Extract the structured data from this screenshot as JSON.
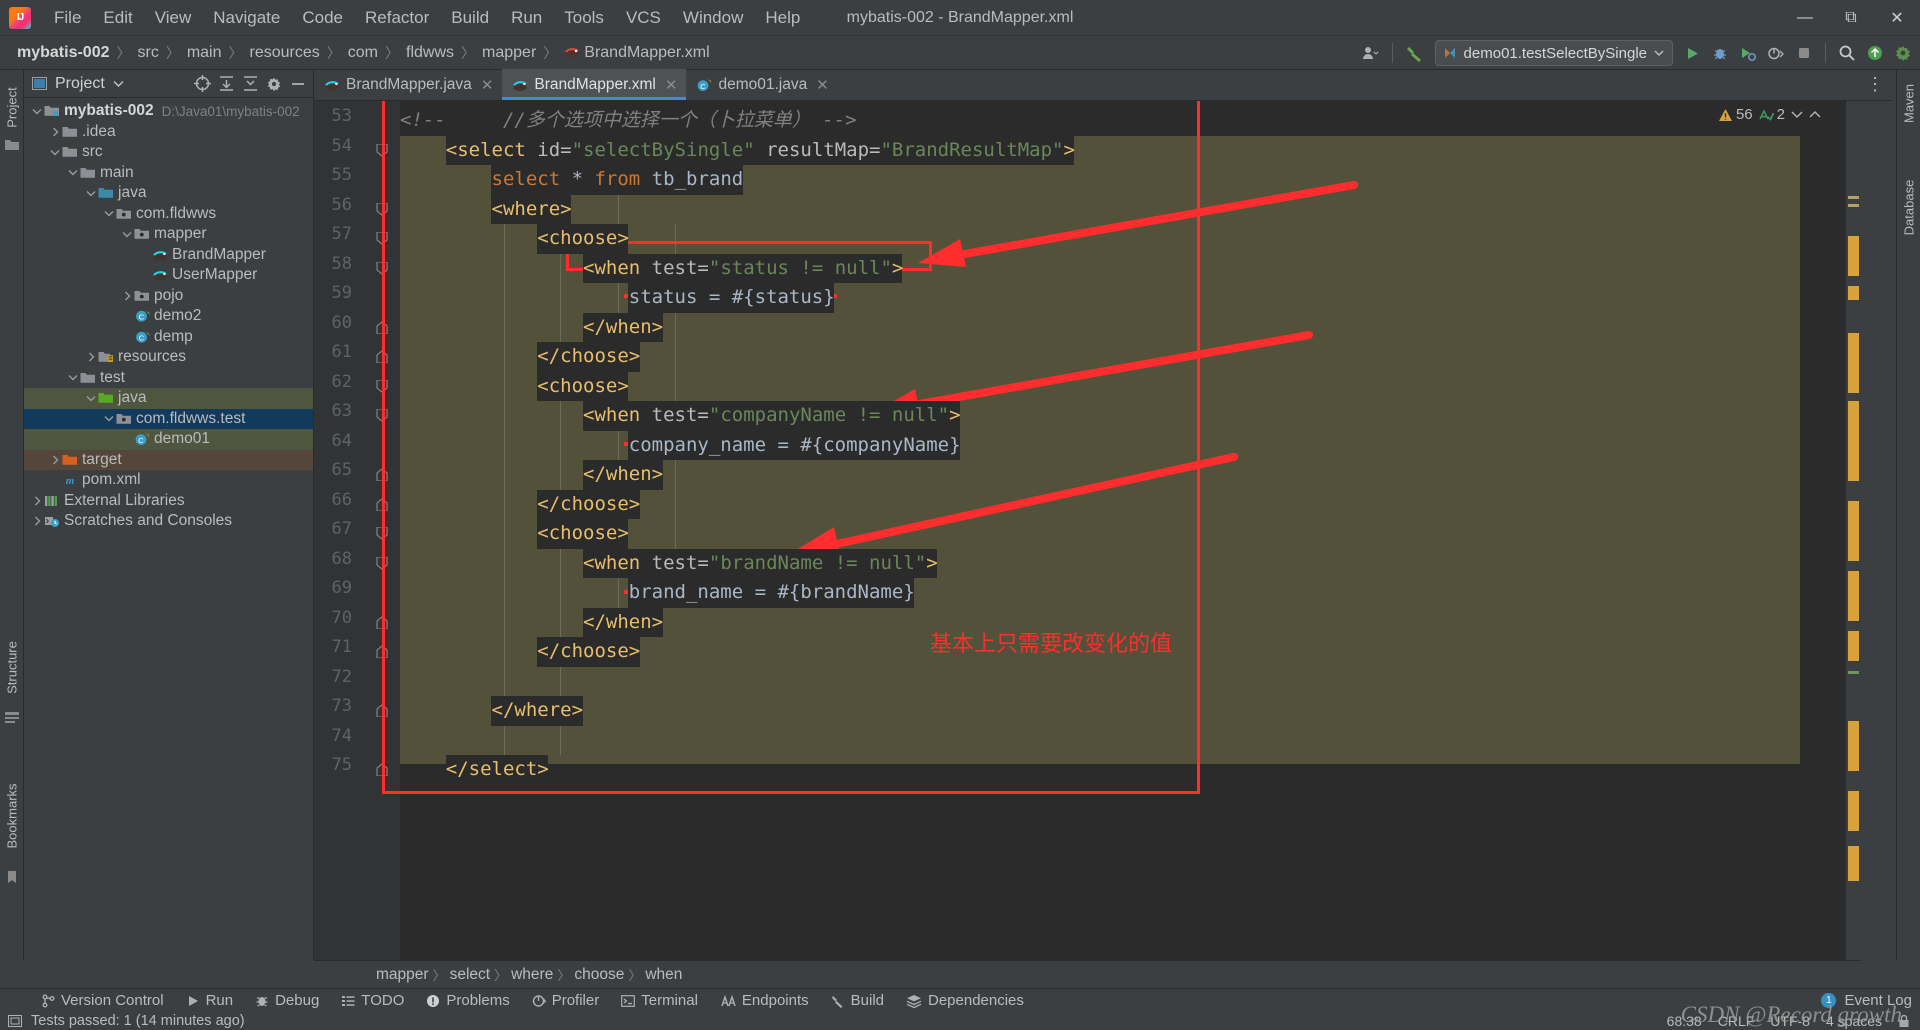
{
  "window": {
    "title": "mybatis-002 - BrandMapper.xml",
    "logo_icon": "intellij-idea-logo",
    "controls": [
      {
        "name": "minimize-button",
        "glyph": "—"
      },
      {
        "name": "maximize-button",
        "glyph": "❐"
      },
      {
        "name": "close-button",
        "glyph": "✕"
      }
    ]
  },
  "menubar": {
    "items": [
      "File",
      "Edit",
      "View",
      "Navigate",
      "Code",
      "Refactor",
      "Build",
      "Run",
      "Tools",
      "VCS",
      "Window",
      "Help"
    ]
  },
  "navbar": {
    "crumbs": [
      {
        "label": "mybatis-002",
        "bold": true,
        "icon": ""
      },
      {
        "label": "src",
        "bold": false,
        "icon": ""
      },
      {
        "label": "main",
        "bold": false,
        "icon": ""
      },
      {
        "label": "resources",
        "bold": false,
        "icon": ""
      },
      {
        "label": "com",
        "bold": false,
        "icon": ""
      },
      {
        "label": "fldwws",
        "bold": false,
        "icon": ""
      },
      {
        "label": "mapper",
        "bold": false,
        "icon": ""
      },
      {
        "label": "BrandMapper.xml",
        "bold": false,
        "icon": "mybatis-file-icon"
      }
    ],
    "separator": "〉",
    "right": {
      "account_icon": "user-account-icon",
      "account_dropdown_icon": "chevron-down-icon",
      "build_icon": "hammer-build-icon",
      "run_config": {
        "icon": "run-config-icon",
        "label": "demo01.testSelectBySingle",
        "dropdown_icon": "chevron-down-icon"
      },
      "run_button": "run-icon",
      "debug_button": "debug-icon",
      "run_coverage_button": "run-with-coverage-icon",
      "profiler_button": "profiler-icon",
      "stop_button": "stop-icon",
      "search_button": "search-icon",
      "updates_button": "updates-icon",
      "settings_button": "settings-icon"
    }
  },
  "left_strip": {
    "project_label": "Project",
    "structure_label": "Structure",
    "bookmarks_label": "Bookmarks",
    "commit_icon": "commit-icon"
  },
  "right_strip": {
    "maven_label": "Maven",
    "database_label": "Database"
  },
  "project_panel": {
    "title": "Project",
    "title_dropdown_icon": "chevron-down-icon",
    "actions": [
      {
        "name": "select-opened-file-button",
        "icon": "crosshair-icon"
      },
      {
        "name": "expand-all-button",
        "icon": "expand-all-icon"
      },
      {
        "name": "collapse-all-button",
        "icon": "collapse-all-icon"
      },
      {
        "name": "settings-button",
        "icon": "gear-icon"
      },
      {
        "name": "hide-button",
        "icon": "minus-icon"
      }
    ],
    "tree": [
      {
        "label": "mybatis-002",
        "sub": "D:\\Java01\\mybatis-002",
        "depth": 0,
        "chev": "down",
        "icon": "module-folder-icon",
        "bold": true,
        "state": ""
      },
      {
        "label": ".idea",
        "sub": "",
        "depth": 1,
        "chev": "right",
        "icon": "folder-icon",
        "bold": false,
        "state": ""
      },
      {
        "label": "src",
        "sub": "",
        "depth": 1,
        "chev": "down",
        "icon": "folder-icon",
        "bold": false,
        "state": ""
      },
      {
        "label": "main",
        "sub": "",
        "depth": 2,
        "chev": "down",
        "icon": "folder-icon",
        "bold": false,
        "state": ""
      },
      {
        "label": "java",
        "sub": "",
        "depth": 3,
        "chev": "down",
        "icon": "source-folder-icon",
        "bold": false,
        "state": ""
      },
      {
        "label": "com.fldwws",
        "sub": "",
        "depth": 4,
        "chev": "down",
        "icon": "package-icon",
        "bold": false,
        "state": ""
      },
      {
        "label": "mapper",
        "sub": "",
        "depth": 5,
        "chev": "down",
        "icon": "package-icon",
        "bold": false,
        "state": ""
      },
      {
        "label": "BrandMapper",
        "sub": "",
        "depth": 6,
        "chev": "none",
        "icon": "mybatis-file-icon",
        "bold": false,
        "state": ""
      },
      {
        "label": "UserMapper",
        "sub": "",
        "depth": 6,
        "chev": "none",
        "icon": "mybatis-file-icon",
        "bold": false,
        "state": ""
      },
      {
        "label": "pojo",
        "sub": "",
        "depth": 5,
        "chev": "right",
        "icon": "package-icon",
        "bold": false,
        "state": ""
      },
      {
        "label": "demo2",
        "sub": "",
        "depth": 5,
        "chev": "none",
        "icon": "java-class-icon",
        "bold": false,
        "state": ""
      },
      {
        "label": "demp",
        "sub": "",
        "depth": 5,
        "chev": "none",
        "icon": "java-class-icon",
        "bold": false,
        "state": ""
      },
      {
        "label": "resources",
        "sub": "",
        "depth": 3,
        "chev": "right",
        "icon": "resource-folder-icon",
        "bold": false,
        "state": ""
      },
      {
        "label": "test",
        "sub": "",
        "depth": 2,
        "chev": "down",
        "icon": "folder-icon",
        "bold": false,
        "state": ""
      },
      {
        "label": "java",
        "sub": "",
        "depth": 3,
        "chev": "down",
        "icon": "test-source-folder-icon",
        "bold": false,
        "state": "sel-green"
      },
      {
        "label": "com.fldwws.test",
        "sub": "",
        "depth": 4,
        "chev": "down",
        "icon": "package-icon",
        "bold": false,
        "state": "sel-blue"
      },
      {
        "label": "demo01",
        "sub": "",
        "depth": 5,
        "chev": "none",
        "icon": "java-test-class-icon",
        "bold": false,
        "state": "sel-green"
      },
      {
        "label": "target",
        "sub": "",
        "depth": 1,
        "chev": "right",
        "icon": "excluded-folder-icon",
        "bold": false,
        "state": "sel-brown"
      },
      {
        "label": "pom.xml",
        "sub": "",
        "depth": 1,
        "chev": "none",
        "icon": "maven-icon",
        "bold": false,
        "state": ""
      },
      {
        "label": "External Libraries",
        "sub": "",
        "depth": 0,
        "chev": "right",
        "icon": "libraries-icon",
        "bold": false,
        "state": ""
      },
      {
        "label": "Scratches and Consoles",
        "sub": "",
        "depth": 0,
        "chev": "right",
        "icon": "scratches-icon",
        "bold": false,
        "state": ""
      }
    ]
  },
  "editor_tabs": [
    {
      "label": "BrandMapper.java",
      "icon": "mybatis-file-icon",
      "active": false,
      "close_icon": "close-icon"
    },
    {
      "label": "BrandMapper.xml",
      "icon": "mybatis-file-icon",
      "active": true,
      "close_icon": "close-icon"
    },
    {
      "label": "demo01.java",
      "icon": "java-test-class-icon",
      "active": false,
      "close_icon": "close-icon"
    }
  ],
  "tabs_overflow_icon": "more-options-icon",
  "inspections": {
    "warning_icon": "warning-triangle-icon",
    "warning_count": "56",
    "typo_icon": "typo-icon",
    "typo_count": "2",
    "prev_icon": "chevron-down-icon",
    "next_icon": "chevron-up-icon",
    "status_icon": "inspection-ok-icon"
  },
  "code": {
    "first_line_number": 53,
    "lines": [
      {
        "n": 53,
        "indent": 0,
        "fold": "",
        "tokens": [
          {
            "t": "<!--",
            "c": "tok-comment"
          },
          {
            "t": "     //多个选项中选择一个（卜拉菜单） -->",
            "c": "tok-comment"
          }
        ]
      },
      {
        "n": 54,
        "indent": 0,
        "fold": "open",
        "tokens": [
          {
            "t": "    <select ",
            "c": "tok-tag"
          },
          {
            "t": "id=",
            "c": "tok-attr"
          },
          {
            "t": "\"selectBySingle\" ",
            "c": "tok-str"
          },
          {
            "t": "resultMap=",
            "c": "tok-attr"
          },
          {
            "t": "\"BrandResultMap\"",
            "c": "tok-str"
          },
          {
            "t": ">",
            "c": "tok-tag"
          }
        ]
      },
      {
        "n": 55,
        "indent": 0,
        "fold": "",
        "tokens": [
          {
            "t": "        select ",
            "c": "tok-kw"
          },
          {
            "t": "* ",
            "c": "tok-plain"
          },
          {
            "t": "from ",
            "c": "tok-kw"
          },
          {
            "t": "tb_brand",
            "c": "tok-plain"
          }
        ]
      },
      {
        "n": 56,
        "indent": 0,
        "fold": "open",
        "tokens": [
          {
            "t": "        <where>",
            "c": "tok-tag"
          }
        ]
      },
      {
        "n": 57,
        "indent": 0,
        "fold": "open",
        "tokens": [
          {
            "t": "            <choose>",
            "c": "tok-tag"
          }
        ]
      },
      {
        "n": 58,
        "indent": 0,
        "fold": "open",
        "tokens": [
          {
            "t": "                <when ",
            "c": "tok-tag"
          },
          {
            "t": "test=",
            "c": "tok-attr"
          },
          {
            "t": "\"status != null\"",
            "c": "tok-str"
          },
          {
            "t": ">",
            "c": "tok-tag"
          }
        ]
      },
      {
        "n": 59,
        "indent": 0,
        "fold": "",
        "tokens": [
          {
            "t": "                    status = #{status}",
            "c": "tok-plain"
          }
        ]
      },
      {
        "n": 60,
        "indent": 0,
        "fold": "close",
        "tokens": [
          {
            "t": "                </when>",
            "c": "tok-tag"
          }
        ]
      },
      {
        "n": 61,
        "indent": 0,
        "fold": "close",
        "tokens": [
          {
            "t": "            </choose>",
            "c": "tok-tag"
          }
        ]
      },
      {
        "n": 62,
        "indent": 0,
        "fold": "open",
        "tokens": [
          {
            "t": "            <choose>",
            "c": "tok-tag"
          }
        ]
      },
      {
        "n": 63,
        "indent": 0,
        "fold": "open",
        "tokens": [
          {
            "t": "                <when ",
            "c": "tok-tag"
          },
          {
            "t": "test=",
            "c": "tok-attr"
          },
          {
            "t": "\"companyName != null\"",
            "c": "tok-str"
          },
          {
            "t": ">",
            "c": "tok-tag"
          }
        ]
      },
      {
        "n": 64,
        "indent": 0,
        "fold": "",
        "tokens": [
          {
            "t": "                    company_name = #{companyName}",
            "c": "tok-plain"
          }
        ]
      },
      {
        "n": 65,
        "indent": 0,
        "fold": "close",
        "tokens": [
          {
            "t": "                </when>",
            "c": "tok-tag"
          }
        ]
      },
      {
        "n": 66,
        "indent": 0,
        "fold": "close",
        "tokens": [
          {
            "t": "            </choose>",
            "c": "tok-tag"
          }
        ]
      },
      {
        "n": 67,
        "indent": 0,
        "fold": "open",
        "tokens": [
          {
            "t": "            <choose>",
            "c": "tok-tag"
          }
        ]
      },
      {
        "n": 68,
        "indent": 0,
        "fold": "open",
        "tokens": [
          {
            "t": "                <when ",
            "c": "tok-tag"
          },
          {
            "t": "test=",
            "c": "tok-attr"
          },
          {
            "t": "\"brandName != null\"",
            "c": "tok-str"
          },
          {
            "t": ">",
            "c": "tok-tag"
          }
        ]
      },
      {
        "n": 69,
        "indent": 0,
        "fold": "",
        "tokens": [
          {
            "t": "                    brand_name = #{brandName}",
            "c": "tok-plain"
          }
        ]
      },
      {
        "n": 70,
        "indent": 0,
        "fold": "close",
        "tokens": [
          {
            "t": "                </when>",
            "c": "tok-tag"
          }
        ]
      },
      {
        "n": 71,
        "indent": 0,
        "fold": "close",
        "tokens": [
          {
            "t": "            </choose>",
            "c": "tok-tag"
          }
        ]
      },
      {
        "n": 72,
        "indent": 0,
        "fold": "",
        "tokens": []
      },
      {
        "n": 73,
        "indent": 0,
        "fold": "close",
        "tokens": [
          {
            "t": "        </where>",
            "c": "tok-tag"
          }
        ]
      },
      {
        "n": 74,
        "indent": 0,
        "fold": "",
        "tokens": []
      },
      {
        "n": 75,
        "indent": 0,
        "fold": "close",
        "tokens": [
          {
            "t": "    </select>",
            "c": "tok-tag"
          }
        ]
      }
    ]
  },
  "annotations": {
    "note_text": "基本上只需要改变化的值",
    "accent_color": "#ff2d2d",
    "highlight_boxes": [
      "when test=\"status != null\""
    ],
    "underlines": [
      "status = #{status}",
      "company_name = #{companyName}",
      "brand_name = #{brandName}"
    ],
    "arrows": 3
  },
  "editor_breadcrumbs": {
    "items": [
      "mapper",
      "select",
      "where",
      "choose",
      "when"
    ],
    "separator": "〉"
  },
  "bottom_bar": {
    "items": [
      {
        "label": "Version Control",
        "icon": "branch-icon"
      },
      {
        "label": "Run",
        "icon": "run-icon"
      },
      {
        "label": "Debug",
        "icon": "debug-icon"
      },
      {
        "label": "TODO",
        "icon": "todo-icon"
      },
      {
        "label": "Problems",
        "icon": "problems-icon"
      },
      {
        "label": "Profiler",
        "icon": "profiler-icon"
      },
      {
        "label": "Terminal",
        "icon": "terminal-icon"
      },
      {
        "label": "Endpoints",
        "icon": "endpoints-icon"
      },
      {
        "label": "Build",
        "icon": "build-icon"
      },
      {
        "label": "Dependencies",
        "icon": "dependencies-icon"
      }
    ],
    "event_log": {
      "label": "Event Log",
      "badge": "1"
    }
  },
  "status_bar": {
    "icon": "console-icon",
    "message": "Tests passed: 1 (14 minutes ago)",
    "caret": "68:38",
    "line_separator": "CRLF",
    "encoding": "UTF-8",
    "indent": "4 spaces",
    "lock_icon": "lock-icon"
  },
  "watermark": "CSDN @Record growth"
}
